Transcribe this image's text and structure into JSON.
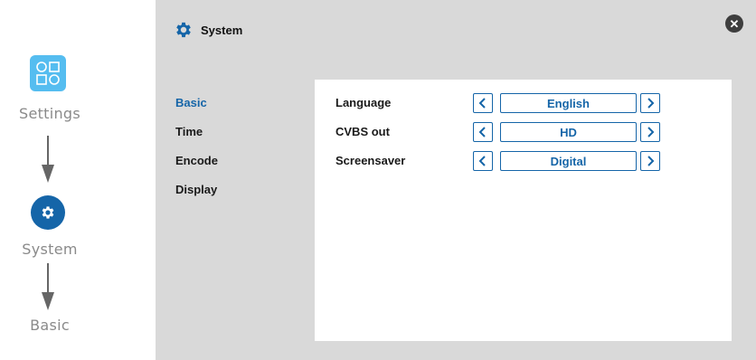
{
  "flow": {
    "steps": [
      {
        "label": "Settings"
      },
      {
        "label": "System"
      },
      {
        "label": "Basic"
      }
    ]
  },
  "panel": {
    "title": "System",
    "close_icon": "close-icon"
  },
  "menu": {
    "items": [
      {
        "label": "Basic",
        "active": true
      },
      {
        "label": "Time",
        "active": false
      },
      {
        "label": "Encode",
        "active": false
      },
      {
        "label": "Display",
        "active": false
      }
    ]
  },
  "settings": {
    "rows": [
      {
        "label": "Language",
        "value": "English"
      },
      {
        "label": "CVBS out",
        "value": "HD"
      },
      {
        "label": "Screensaver",
        "value": "Digital"
      }
    ]
  },
  "colors": {
    "accent": "#1565a8",
    "settings_tile": "#55bdf0",
    "panel_bg": "#d9d9d9"
  }
}
